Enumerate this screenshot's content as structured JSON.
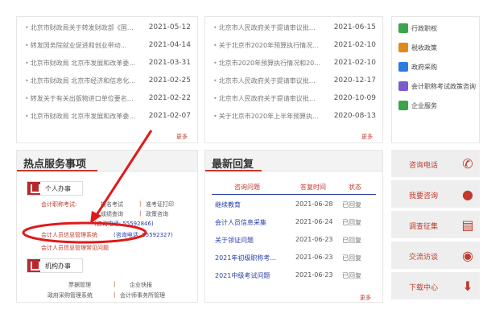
{
  "top_left_news": {
    "items": [
      {
        "title": "北京市财政局关于转发财政部《国际...",
        "date": "2021-05-12"
      },
      {
        "title": "转发国务院就业促进和创业带动...",
        "date": "2021-04-14"
      },
      {
        "title": "北京市财政局 北京市发展和改革委员...",
        "date": "2021-03-31"
      },
      {
        "title": "北京市财政局 北京市经济和信息化局...",
        "date": "2021-02-25"
      },
      {
        "title": "转发关于有关出版物进口单位要名后...",
        "date": "2021-02-22"
      },
      {
        "title": "北京市财政局 北京市发展和改革委员...",
        "date": "2021-02-07"
      }
    ],
    "more": "更多"
  },
  "top_mid_news": {
    "items": [
      {
        "title": "北京市人民政府关于提请审议批准...",
        "date": "2021-06-15"
      },
      {
        "title": "关于北京市2020年预算执行情况和2021...",
        "date": "2021-02-10"
      },
      {
        "title": "北京市2020年预算执行情况和2021...",
        "date": "2021-02-10"
      },
      {
        "title": "北京市人民政府关于提请审议批准...",
        "date": "2020-12-17"
      },
      {
        "title": "北京市人民政府关于提请审议批准...",
        "date": "2020-10-09"
      },
      {
        "title": "关于北京市2020年上半年预算执行...",
        "date": "2020-08-13"
      }
    ],
    "more": "更多"
  },
  "top_right_menu": [
    {
      "label": "行政职权",
      "color": "#3aa54a"
    },
    {
      "label": "税收政策",
      "color": "#e08a1e"
    },
    {
      "label": "政府采购",
      "color": "#2d7be0"
    },
    {
      "label": "会计职称考试政策咨询",
      "color": "#7a5cc9"
    },
    {
      "label": "企业服务",
      "color": "#3aa54a"
    }
  ],
  "hot_services": {
    "title": "热点服务事项",
    "personal_label": "个人办事",
    "accounting_exam": "会计职称考试:",
    "links_row1": [
      "报名考试",
      "准考证打印"
    ],
    "links_row2": [
      "成绩查询",
      "政策咨询"
    ],
    "phone_note": "(咨询电话: 55592846)",
    "mgmt_system": "会计人员信息管理系统",
    "mgmt_phone": "(咨询电话: 55592327)",
    "faq": "会计人员信息管理常见问题",
    "org_label": "机构办事",
    "org_links": [
      [
        "票据管理",
        "企业快报"
      ],
      [
        "政府采购管理系统",
        "会计师事务所管理"
      ]
    ]
  },
  "latest_replies": {
    "title": "最新回复",
    "headers": [
      "咨询问题",
      "答复时间",
      "状态"
    ],
    "rows": [
      {
        "q": "继续教育",
        "date": "2021-06-28",
        "status": "已回复"
      },
      {
        "q": "会计人员信息采集",
        "date": "2021-06-24",
        "status": "已回复"
      },
      {
        "q": "关于领证问题",
        "date": "2021-06-23",
        "status": "已回复"
      },
      {
        "q": "2021年初级职称考...",
        "date": "2021-06-23",
        "status": "已回复"
      },
      {
        "q": "2021中级考试问题",
        "date": "2021-06-23",
        "status": "已回复"
      }
    ],
    "more": "更多"
  },
  "service_buttons": [
    {
      "label": "咨询电话",
      "icon": "phone-icon"
    },
    {
      "label": "我要咨询",
      "icon": "chat-icon"
    },
    {
      "label": "调查征集",
      "icon": "clipboard-icon"
    },
    {
      "label": "交流访谈",
      "icon": "interview-icon"
    },
    {
      "label": "下载中心",
      "icon": "download-icon"
    }
  ]
}
